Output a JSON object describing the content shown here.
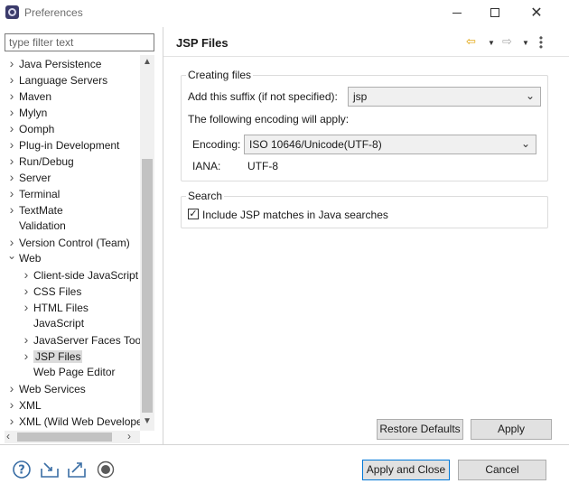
{
  "window": {
    "title": "Preferences"
  },
  "filter": {
    "placeholder": "type filter text"
  },
  "tree": [
    {
      "label": "Java Persistence",
      "level": 0,
      "expander": "collapsed"
    },
    {
      "label": "Language Servers",
      "level": 0,
      "expander": "collapsed"
    },
    {
      "label": "Maven",
      "level": 0,
      "expander": "collapsed"
    },
    {
      "label": "Mylyn",
      "level": 0,
      "expander": "collapsed"
    },
    {
      "label": "Oomph",
      "level": 0,
      "expander": "collapsed"
    },
    {
      "label": "Plug-in Development",
      "level": 0,
      "expander": "collapsed"
    },
    {
      "label": "Run/Debug",
      "level": 0,
      "expander": "collapsed"
    },
    {
      "label": "Server",
      "level": 0,
      "expander": "collapsed"
    },
    {
      "label": "Terminal",
      "level": 0,
      "expander": "collapsed"
    },
    {
      "label": "TextMate",
      "level": 0,
      "expander": "collapsed"
    },
    {
      "label": "Validation",
      "level": 0,
      "expander": "none"
    },
    {
      "label": "Version Control (Team)",
      "level": 0,
      "expander": "collapsed"
    },
    {
      "label": "Web",
      "level": 0,
      "expander": "expanded"
    },
    {
      "label": "Client-side JavaScript",
      "level": 1,
      "expander": "collapsed"
    },
    {
      "label": "CSS Files",
      "level": 1,
      "expander": "collapsed"
    },
    {
      "label": "HTML Files",
      "level": 1,
      "expander": "collapsed"
    },
    {
      "label": "JavaScript",
      "level": 1,
      "expander": "none"
    },
    {
      "label": "JavaServer Faces Tools",
      "level": 1,
      "expander": "collapsed"
    },
    {
      "label": "JSP Files",
      "level": 1,
      "expander": "collapsed",
      "selected": true
    },
    {
      "label": "Web Page Editor",
      "level": 1,
      "expander": "none"
    },
    {
      "label": "Web Services",
      "level": 0,
      "expander": "collapsed"
    },
    {
      "label": "XML",
      "level": 0,
      "expander": "collapsed"
    },
    {
      "label": "XML (Wild Web Developer)",
      "level": 0,
      "expander": "collapsed"
    }
  ],
  "page": {
    "title": "JSP Files",
    "creating_files": {
      "group_label": "Creating files",
      "suffix_label": "Add this suffix (if not specified):",
      "suffix_value": "jsp",
      "encoding_intro": "The following encoding will apply:",
      "encoding_label": "Encoding:",
      "encoding_value": "ISO 10646/Unicode(UTF-8)",
      "iana_label": "IANA:",
      "iana_value": "UTF-8"
    },
    "search": {
      "group_label": "Search",
      "checkbox_label": "Include JSP matches in Java searches",
      "checked": true
    },
    "restore_defaults": "Restore Defaults",
    "apply": "Apply"
  },
  "footer": {
    "apply_and_close": "Apply and Close",
    "cancel": "Cancel",
    "icons": [
      "help-icon",
      "import-icon",
      "export-icon",
      "record-icon"
    ]
  }
}
